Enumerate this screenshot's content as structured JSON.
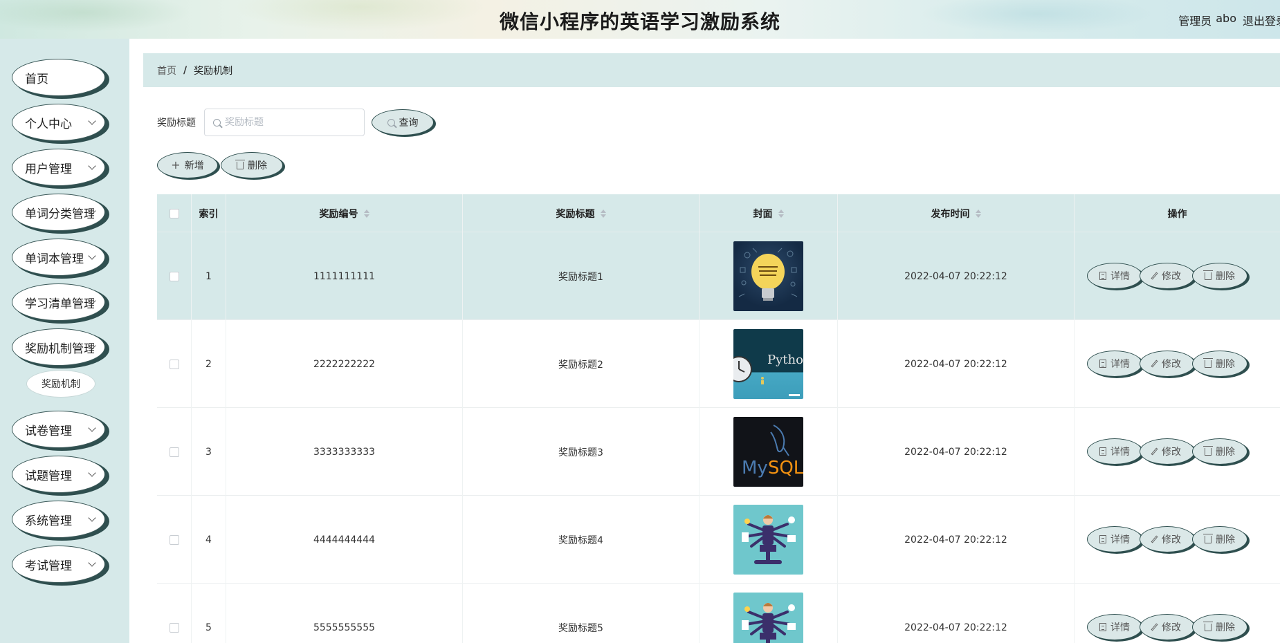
{
  "header": {
    "title": "微信小程序的英语学习激励系统",
    "admin_prefix": "管理员",
    "admin_name": "abo",
    "logout": "退出登录"
  },
  "sidebar": {
    "items": [
      {
        "label": "首页",
        "has_arrow": false
      },
      {
        "label": "个人中心",
        "has_arrow": true
      },
      {
        "label": "用户管理",
        "has_arrow": true
      },
      {
        "label": "单词分类管理",
        "has_arrow": true
      },
      {
        "label": "单词本管理",
        "has_arrow": true
      },
      {
        "label": "学习清单管理",
        "has_arrow": true
      },
      {
        "label": "奖励机制管理",
        "has_arrow": true
      },
      {
        "label": "试卷管理",
        "has_arrow": true
      },
      {
        "label": "试题管理",
        "has_arrow": true
      },
      {
        "label": "系统管理",
        "has_arrow": true
      },
      {
        "label": "考试管理",
        "has_arrow": true
      }
    ],
    "submenu_active": "奖励机制"
  },
  "breadcrumb": {
    "home": "首页",
    "separator": "/",
    "current": "奖励机制"
  },
  "search": {
    "label": "奖励标题",
    "placeholder": "奖励标题",
    "button": "查询"
  },
  "actions": {
    "add": "新增",
    "delete": "删除"
  },
  "table": {
    "columns": [
      "索引",
      "奖励编号",
      "奖励标题",
      "封面",
      "发布时间",
      "操作"
    ],
    "rows": [
      {
        "index": "1",
        "code": "1111111111",
        "title": "奖励标题1",
        "cover": "lightbulb-cover",
        "time": "2022-04-07 20:22:12"
      },
      {
        "index": "2",
        "code": "2222222222",
        "title": "奖励标题2",
        "cover": "python-cover",
        "time": "2022-04-07 20:22:12"
      },
      {
        "index": "3",
        "code": "3333333333",
        "title": "奖励标题3",
        "cover": "mysql-cover",
        "time": "2022-04-07 20:22:12"
      },
      {
        "index": "4",
        "code": "4444444444",
        "title": "奖励标题4",
        "cover": "multitask-cover",
        "time": "2022-04-07 20:22:12"
      },
      {
        "index": "5",
        "code": "5555555555",
        "title": "奖励标题5",
        "cover": "multitask-cover",
        "time": "2022-04-07 20:22:12"
      }
    ],
    "row_actions": {
      "detail": "详情",
      "edit": "修改",
      "delete": "删除"
    },
    "cover_text": {
      "python": "Python",
      "mysql_my": "My",
      "mysql_sql": "SQL"
    }
  },
  "colors": {
    "accent": "#d6e9e9",
    "button_border": "#2f4f4f",
    "highlight_row": "#d6e9e9"
  }
}
